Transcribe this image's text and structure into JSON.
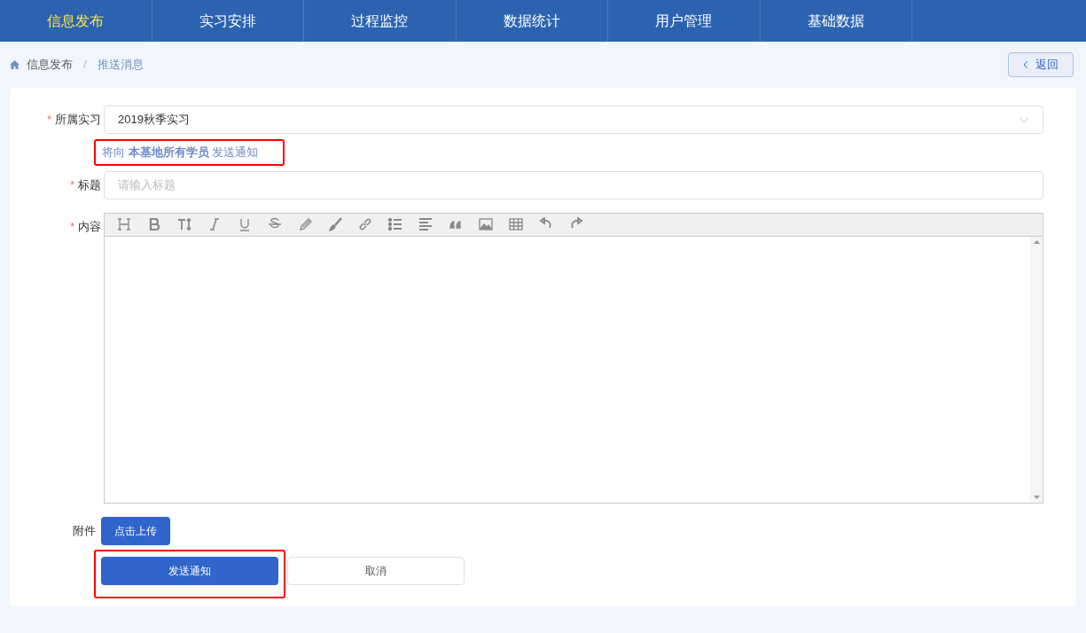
{
  "nav": {
    "items": [
      {
        "label": "信息发布",
        "selected": true
      },
      {
        "label": "实习安排",
        "selected": false
      },
      {
        "label": "过程监控",
        "selected": false
      },
      {
        "label": "数据统计",
        "selected": false
      },
      {
        "label": "用户管理",
        "selected": false
      },
      {
        "label": "基础数据",
        "selected": false
      }
    ]
  },
  "breadcrumb": [
    "信息发布",
    "推送消息"
  ],
  "breadcrumb_separator": "/",
  "back_button": "返回",
  "form": {
    "internship": {
      "label": "所属实习",
      "required_mark": "*",
      "value": "2019秋季实习"
    },
    "hint": "将向 **本基地所有学员** 发送通知",
    "title": {
      "label": "标题",
      "required_mark": "*",
      "placeholder": "请输入标题"
    },
    "content": {
      "label": "内容",
      "required_mark": "*"
    },
    "attachment": {
      "label": "附件",
      "button": "点击上传"
    },
    "buttons": [
      "发送通知",
      "取消"
    ]
  }
}
